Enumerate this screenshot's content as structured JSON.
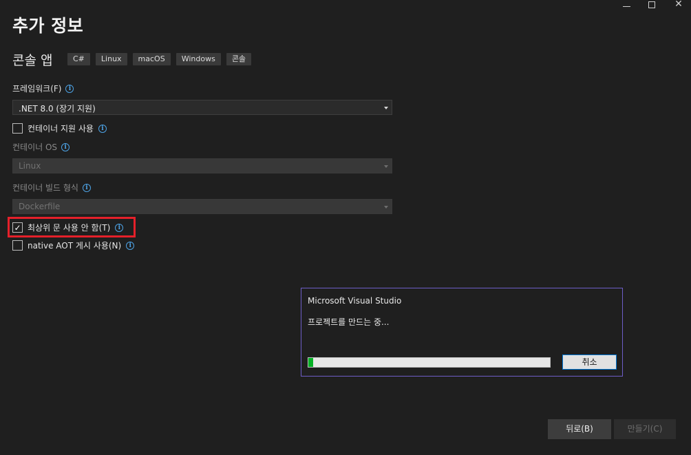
{
  "page": {
    "title": "추가 정보",
    "template_name": "콘솔 앱",
    "tags": [
      "C#",
      "Linux",
      "macOS",
      "Windows",
      "콘솔"
    ]
  },
  "form": {
    "framework_label": "프레임워크(F)",
    "framework_value": ".NET 8.0 (장기 지원)",
    "container_support_label": "컨테이너 지원 사용",
    "container_support_checked": false,
    "container_os_label": "컨테이너 OS",
    "container_os_value": "Linux",
    "container_build_label": "컨테이너 빌드 형식",
    "container_build_value": "Dockerfile",
    "top_level_label": "최상위 문 사용 안 함(T)",
    "top_level_checked": true,
    "aot_label": "native AOT 게시 사용(N)",
    "aot_checked": false
  },
  "dialog": {
    "title": "Microsoft Visual Studio",
    "message": "프로젝트를 만드는 중...",
    "progress_fraction": 0.02,
    "cancel_label": "취소"
  },
  "footer": {
    "back_label": "뒤로(B)",
    "create_label": "만들기(C)"
  },
  "icons": {
    "info": "info-icon",
    "check": "check-icon",
    "caret": "chevron-down-icon"
  },
  "colors": {
    "background": "#1f1f1f",
    "info_accent": "#4da3e6",
    "highlight": "#e5202a",
    "dialog_border": "#6e5ec9",
    "progress": "#06b025"
  }
}
